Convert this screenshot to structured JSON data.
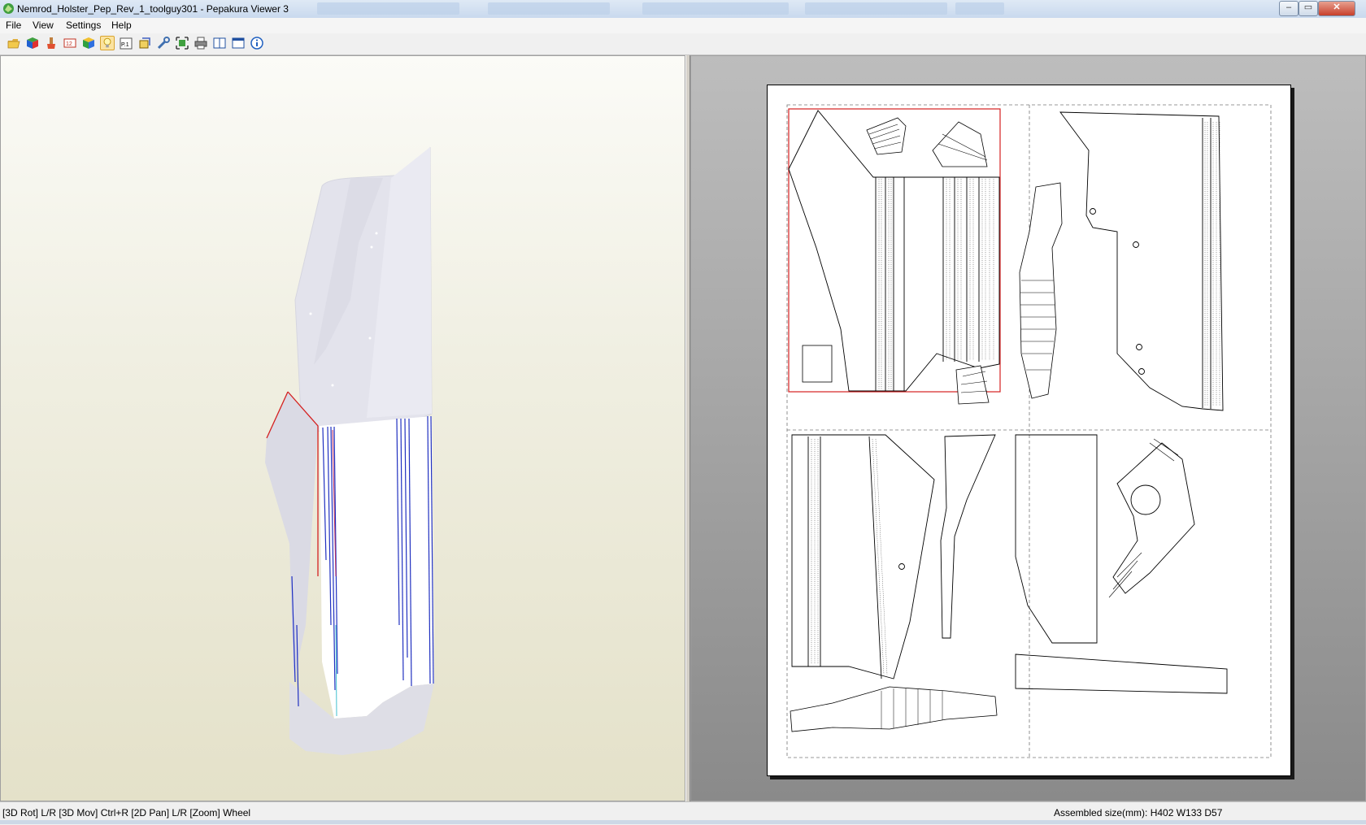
{
  "window": {
    "title": "Nemrod_Holster_Pep_Rev_1_toolguy301 - Pepakura Viewer 3",
    "minimize": "–",
    "maximize": "▭",
    "close": "✕"
  },
  "menu": {
    "items": [
      "File",
      "View",
      "Settings",
      "Help"
    ]
  },
  "toolbar": {
    "buttons": [
      {
        "icon": "open-folder-icon"
      },
      {
        "icon": "3d-cube-color-icon"
      },
      {
        "icon": "brush-icon"
      },
      {
        "icon": "numbering-icon"
      },
      {
        "icon": "texture-cube-icon"
      },
      {
        "icon": "lightbulb-icon",
        "active": true
      },
      {
        "icon": "page-number-icon"
      },
      {
        "icon": "flaps-icon"
      },
      {
        "icon": "wrench-icon"
      },
      {
        "icon": "fit-view-icon"
      },
      {
        "icon": "printer-icon"
      },
      {
        "icon": "split-view-icon"
      },
      {
        "icon": "single-view-icon"
      },
      {
        "icon": "info-icon"
      }
    ],
    "page_label": "P.1"
  },
  "status": {
    "left": "[3D Rot] L/R [3D Mov] Ctrl+R [2D Pan] L/R [Zoom] Wheel",
    "right": "Assembled size(mm): H402 W133 D57"
  },
  "colors": {
    "selection": "#d42020",
    "edge_blue": "#2030c0",
    "model_fill": "#dcdce6"
  }
}
